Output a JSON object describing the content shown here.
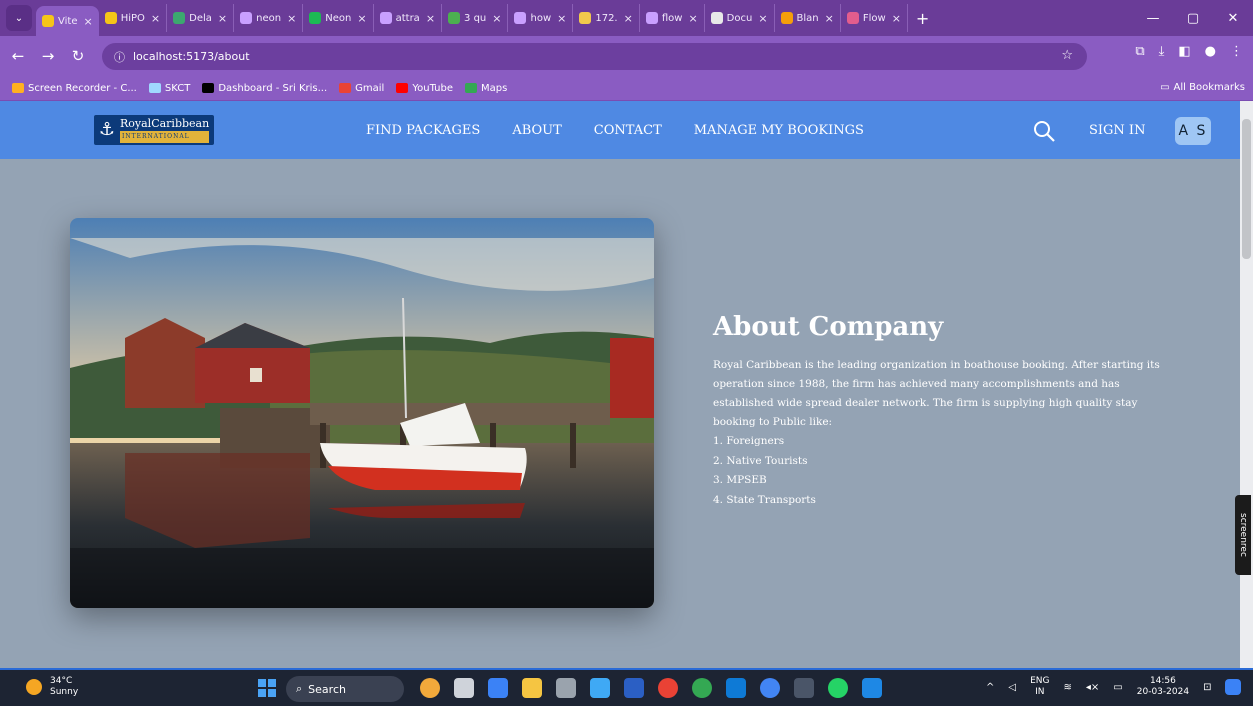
{
  "browser": {
    "tabs": [
      {
        "label": "Vite",
        "color": "#f5c518",
        "active": true
      },
      {
        "label": "HiPO",
        "color": "#f5c518"
      },
      {
        "label": "Dela",
        "color": "#3ca86f"
      },
      {
        "label": "neon",
        "color": "#c9a0ff"
      },
      {
        "label": "Neon",
        "color": "#1db954"
      },
      {
        "label": "attra",
        "color": "#c9a0ff"
      },
      {
        "label": "3 qu",
        "color": "#4caf50"
      },
      {
        "label": "how",
        "color": "#c9a0ff"
      },
      {
        "label": "172.",
        "color": "#f2c94c"
      },
      {
        "label": "flow",
        "color": "#c9a0ff"
      },
      {
        "label": "Docu",
        "color": "#e8e8e8"
      },
      {
        "label": "Blan",
        "color": "#f59e0b"
      },
      {
        "label": "Flow",
        "color": "#e35d8d"
      }
    ],
    "url": "localhost:5173/about",
    "bookmarks": [
      {
        "label": "Screen Recorder - C...",
        "color": "#ffb020"
      },
      {
        "label": "SKCT",
        "color": "#a0d8ff"
      },
      {
        "label": "Dashboard - Sri Kris...",
        "color": "#000000"
      },
      {
        "label": "Gmail",
        "color": "#ea4335"
      },
      {
        "label": "YouTube",
        "color": "#ff0000"
      },
      {
        "label": "Maps",
        "color": "#34a853"
      }
    ],
    "all_bookmarks_label": "All Bookmarks"
  },
  "site": {
    "logo_name": "RoyalCaribbean",
    "logo_sub": "INTERNATIONAL",
    "nav": {
      "find_packages": "FIND PACKAGES",
      "about": "ABOUT",
      "contact": "CONTACT",
      "manage_bookings": "MANAGE MY BOOKINGS"
    },
    "sign_in": "SIGN IN",
    "avatar_initials": "A S",
    "accent_color": "#4f89e3"
  },
  "about": {
    "title": "About Company",
    "description": "Royal Caribbean is the leading organization in boathouse booking. After starting its operation since 1988, the firm has achieved many accomplishments and has established wide spread dealer network. The firm is supplying high quality stay booking to Public like:",
    "list": [
      "1. Foreigners",
      "2. Native Tourists",
      "3. MPSEB",
      "4. State Transports"
    ]
  },
  "overlay": {
    "screenrec": "screenrec"
  },
  "taskbar": {
    "temperature": "34°C",
    "weather": "Sunny",
    "search_label": "Search",
    "lang": "ENG",
    "region": "IN",
    "time": "14:56",
    "date": "20-03-2024"
  }
}
